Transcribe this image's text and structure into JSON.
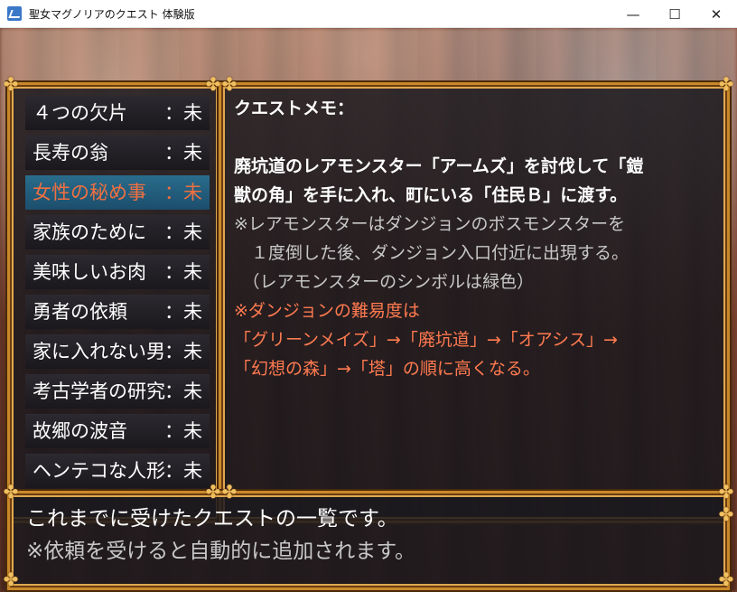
{
  "window": {
    "title": "聖女マグノリアのクエスト 体験版",
    "minimize": "—",
    "maximize": "☐",
    "close": "✕"
  },
  "quests": [
    {
      "name": "４つの欠片",
      "status": "：未"
    },
    {
      "name": "長寿の翁",
      "status": "：未"
    },
    {
      "name": "女性の秘め事",
      "status": "：未",
      "selected": true
    },
    {
      "name": "家族のために",
      "status": "：未"
    },
    {
      "name": "美味しいお肉",
      "status": "：未"
    },
    {
      "name": "勇者の依頼",
      "status": "：未"
    },
    {
      "name": "家に入れない男",
      "status": "：未"
    },
    {
      "name": "考古学者の研究",
      "status": "：未"
    },
    {
      "name": "故郷の波音",
      "status": "：未"
    },
    {
      "name": "ヘンテコな人形",
      "status": "：未"
    }
  ],
  "memo": {
    "heading": "クエストメモ：",
    "line1": "廃坑道のレアモンスター「アームズ」を討伐して「鎧",
    "line2": "獣の角」を手に入れ、町にいる「住民Ｂ」に渡す。",
    "note1": "※レアモンスターはダンジョンのボスモンスターを",
    "note2": "　１度倒した後、ダンジョン入口付近に出現する。",
    "note3": "　（レアモンスターのシンボルは緑色）",
    "warn1": "※ダンジョンの難易度は",
    "warn2": "「グリーンメイズ」→「廃坑道」→「オアシス」→",
    "warn3": "「幻想の森」→「塔」の順に高くなる。"
  },
  "message": {
    "line1": "これまでに受けたクエストの一覧です。",
    "line2": "※依頼を受けると自動的に追加されます。"
  },
  "colors": {
    "frame": "#c9882a",
    "selected_bg": "#2a6c8c",
    "selected_text": "#f07040",
    "gray_text": "#c8c8c8",
    "orange_text": "#ff7a50"
  }
}
